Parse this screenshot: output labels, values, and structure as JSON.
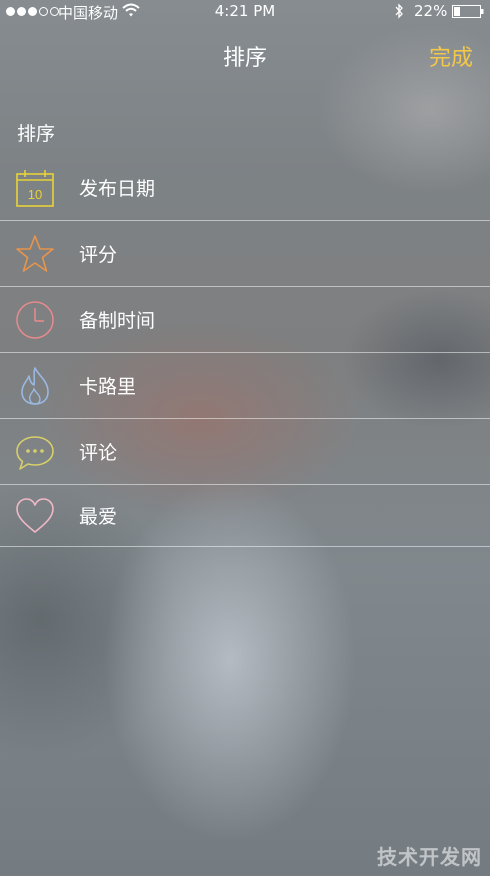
{
  "status_bar": {
    "carrier": "中国移动",
    "time": "4:21 PM",
    "battery": "22%",
    "signal_bars_filled": 3,
    "signal_bars_total": 5
  },
  "nav": {
    "title": "排序",
    "done_label": "完成"
  },
  "section": {
    "header": "排序"
  },
  "items": [
    {
      "label": "发布日期",
      "icon": "calendar-icon",
      "icon_text": "10",
      "color": "#e8d23a"
    },
    {
      "label": "评分",
      "icon": "star-icon",
      "color": "#e8944a"
    },
    {
      "label": "备制时间",
      "icon": "clock-icon",
      "color": "#e48a8c"
    },
    {
      "label": "卡路里",
      "icon": "flame-icon",
      "color": "#9ab8e0"
    },
    {
      "label": "评论",
      "icon": "comment-bubble-icon",
      "color": "#d8cf6a"
    },
    {
      "label": "最爱",
      "icon": "heart-icon",
      "color": "#f0b8c4"
    }
  ],
  "watermark": "技术开发网",
  "colors": {
    "accent": "#f2c84a"
  }
}
